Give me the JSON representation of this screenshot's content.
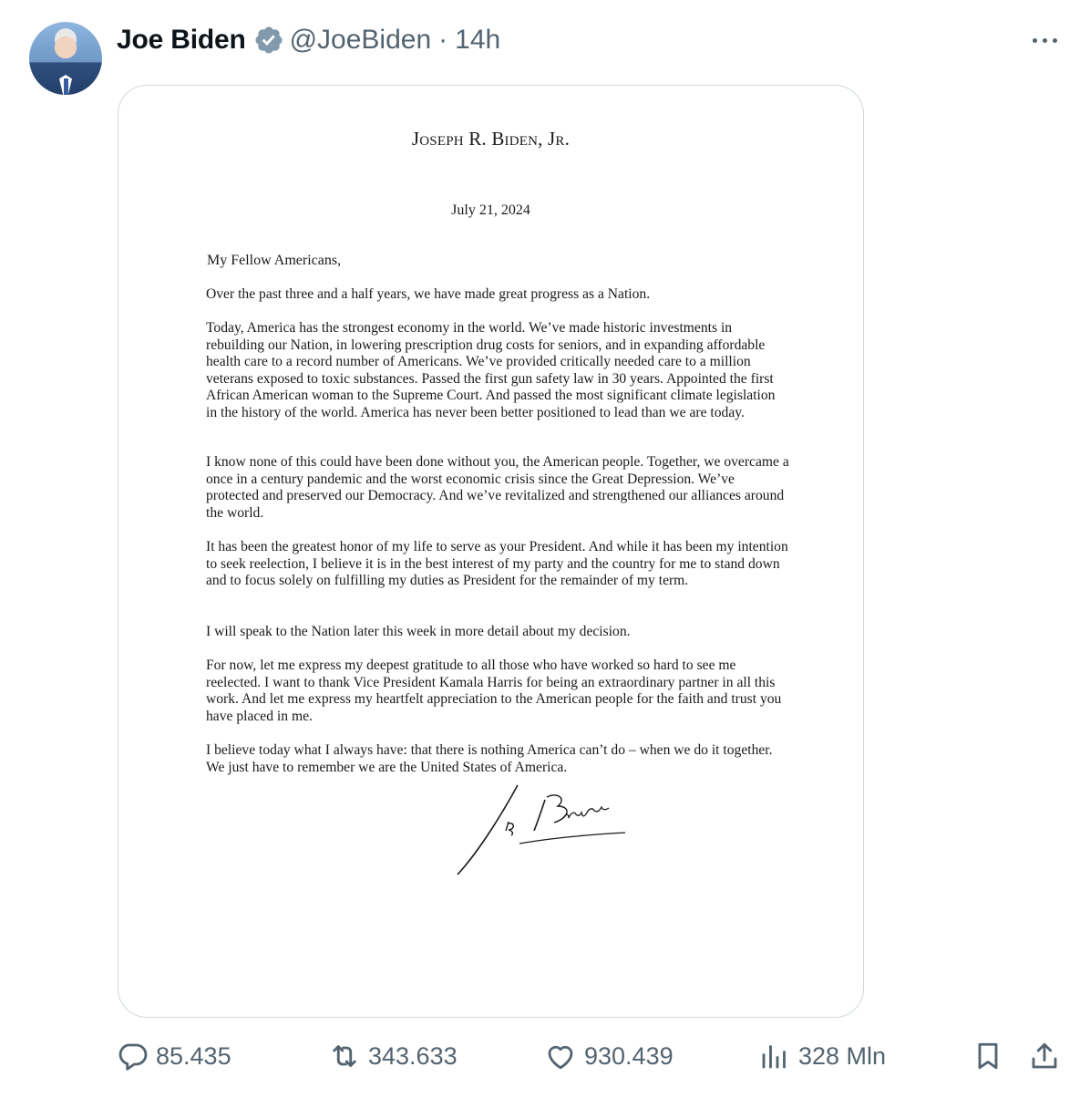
{
  "author": {
    "name": "Joe Biden",
    "handle": "@JoeBiden",
    "separator": "·",
    "time": "14h",
    "avatar_icon": "avatar-photo",
    "verified_icon": "verified-badge-icon"
  },
  "letter": {
    "letterhead": "Joseph R. Biden, Jr.",
    "date": "July 21, 2024",
    "salutation": "My Fellow Americans,",
    "paragraphs": [
      "Over the past three and a half years, we have made great progress as a Nation.",
      "Today, America has the strongest economy in the world. We’ve made historic investments in rebuilding our Nation, in lowering prescription drug costs for seniors, and in expanding affordable health care to a record number of Americans. We’ve provided critically needed care to a million veterans exposed to toxic substances. Passed the first gun safety law in 30 years. Appointed the first African American woman to the Supreme Court. And passed the most significant climate legislation in the history of the world. America has never been better positioned to lead than we are today.",
      "I know none of this could have been done without you, the American people. Together, we overcame a once in a century pandemic and the worst economic crisis since the Great Depression. We’ve protected and preserved our Democracy. And we’ve revitalized and strengthened our alliances around the world.",
      "It has been the greatest honor of my life to serve as your President. And while it has been my intention to seek reelection, I believe it is in the best interest of my party and the country for me to stand down and to focus solely on fulfilling my duties as President for the remainder of my term.",
      "I will speak to the Nation later this week in more detail about my decision.",
      "For now, let me express my deepest gratitude to all those who have worked so hard to see me reelected. I want to thank Vice President Kamala Harris for being an extraordinary partner in all this work. And let me express my heartfelt appreciation to the American people for the faith and trust you have placed in me.",
      "I believe today what I always have: that there is nothing America can’t do – when we do it together. We just have to remember we are the United States of America."
    ],
    "signature": "Joe Biden"
  },
  "actions": {
    "replies": "85.435",
    "reposts": "343.633",
    "likes": "930.439",
    "views": "328 Mln"
  },
  "colors": {
    "text": "#0f1419",
    "muted": "#536471",
    "border": "#cfd9de"
  }
}
